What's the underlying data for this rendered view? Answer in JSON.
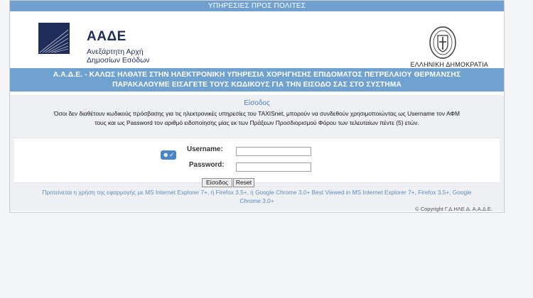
{
  "top_bar": {
    "label": "ΥΠΗΡΕΣΙΕΣ ΠΡΟΣ ΠΟΛΙΤΕΣ"
  },
  "logo": {
    "name": "ΑΑΔΕ",
    "subtitle_line1": "Ανεξάρτητη Αρχή",
    "subtitle_line2": "Δημοσίων Εσόδων",
    "icon": "aade-logo-icon"
  },
  "emblem": {
    "caption": "ΕΛΛΗΝΙΚΗ ΔΗΜΟΚΡΑΤΙΑ",
    "icon": "greek-coat-of-arms-icon"
  },
  "banner": {
    "line1": "Α.Α.Δ.Ε. - ΚΑΛΩΣ ΗΛΘΑΤΕ ΣΤΗΝ ΗΛΕΚΤΡΟΝΙΚΗ ΥΠΗΡΕΣΙΑ ΧΟΡΗΓΗΣΗΣ ΕΠΙΔΟΜΑΤΟΣ ΠΕΤΡΕΛΑΙΟΥ ΘΕΡΜΑΝΣΗΣ",
    "line2": "ΠΑΡΑΚΑΛΟΥΜΕ ΕΙΣΑΓΕΤΕ ΤΟΥΣ ΚΩΔΙΚΟΥΣ ΓΙΑ ΤΗΝ ΕΙΣΟΔΟ ΣΑΣ ΣΤΟ ΣΥΣΤΗΜΑ"
  },
  "login": {
    "title": "Είσοδος",
    "info_line1": "Όσοι δεν διαθέτουν κωδικούς πρόσβασης για τις ηλεκτρονικές υπηρεσίες του TAXISnet, μπορούν να συνδεθούν χρησιμοποιώντας ως Username τον ΑΦΜ",
    "info_line2": "τους και ως Password τον αριθμό ειδοποίησης μίας εκ των Πράξεων Προσδιορισμού Φόρου των τελευταίων πέντε (5) ετών.",
    "username_label": "Username:",
    "password_label": "Password:",
    "username_value": "",
    "password_value": "",
    "user_icon": "user-check-icon",
    "login_button": "Είσοδος",
    "reset_button": "Reset"
  },
  "compat_note": {
    "line1": "Προτείνεται η χρήση της εφαρμογής με MS Internet Explorer 7+, ή Firefox 3.5+, ή Google Chrome 3.0+ Best Viewed in MS Internet Explorer 7+, Firefox 3.5+, Google",
    "line2": "Chrome 3.0+"
  },
  "copyright": "© Copyright Γ.Δ.ΗΛΕ.Δ. Α.Α.Δ.Ε.",
  "colors": {
    "header_blue": "#70a2d1",
    "logo_navy": "#1f2d5a",
    "link_blue": "#5a8cc0"
  }
}
